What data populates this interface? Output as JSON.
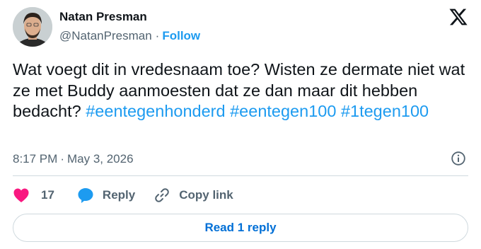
{
  "author": {
    "name": "Natan Presman",
    "handle": "@NatanPresman",
    "separator": "·",
    "follow_label": "Follow"
  },
  "tweet": {
    "text_plain": "Wat voegt dit in vredesnaam toe? Wisten ze dermate niet wat ze met Buddy aanmoesten dat ze dan maar dit hebben bedacht? ",
    "hashtags": [
      "#eentegenhonderd",
      "#eentegen100",
      "#1tegen100"
    ]
  },
  "meta": {
    "time": "8:17 PM",
    "separator": "·",
    "date": "May 3, 2026"
  },
  "actions": {
    "like_count": "17",
    "reply_label": "Reply",
    "copy_link_label": "Copy link"
  },
  "read_replies_label": "Read 1 reply",
  "colors": {
    "accent": "#1d9bf0",
    "like": "#f91880",
    "muted": "#536471",
    "text": "#0f1419"
  },
  "icons": [
    "x-logo-icon",
    "info-icon",
    "heart-icon",
    "reply-bubble-icon",
    "link-icon"
  ]
}
